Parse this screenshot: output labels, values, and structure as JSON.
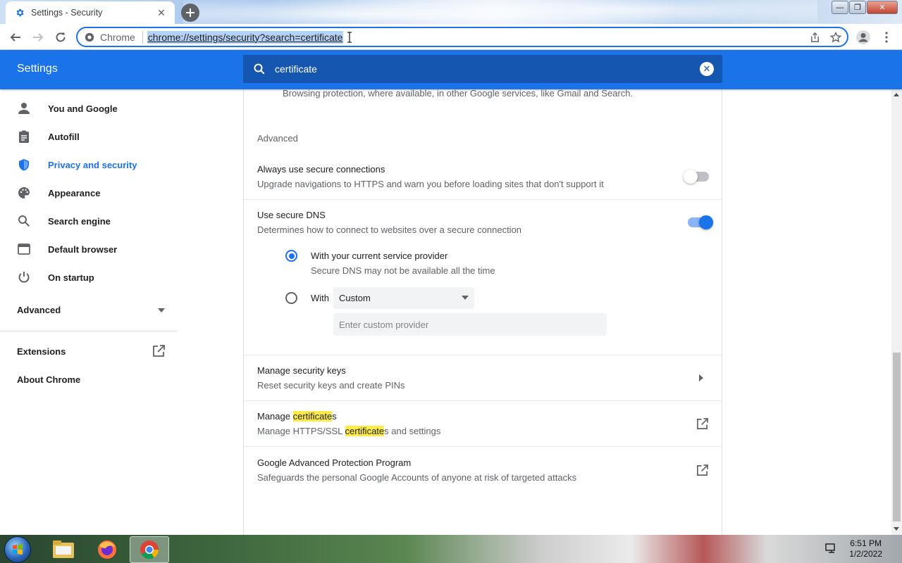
{
  "tab": {
    "title": "Settings - Security",
    "close": "✕"
  },
  "window_controls": {
    "minimize": "—",
    "maximize": "❐",
    "close": "✕"
  },
  "omnibox": {
    "chip_label": "Chrome",
    "url": "chrome://settings/security?search=certificate"
  },
  "settings_header": {
    "title": "Settings",
    "search_query": "certificate"
  },
  "sidebar": {
    "items": [
      {
        "label": "You and Google",
        "icon": "person-icon"
      },
      {
        "label": "Autofill",
        "icon": "clipboard-icon"
      },
      {
        "label": "Privacy and security",
        "icon": "shield-icon",
        "active": true
      },
      {
        "label": "Appearance",
        "icon": "palette-icon"
      },
      {
        "label": "Search engine",
        "icon": "search-icon"
      },
      {
        "label": "Default browser",
        "icon": "browser-icon"
      },
      {
        "label": "On startup",
        "icon": "power-icon"
      }
    ],
    "advanced": "Advanced",
    "extensions": "Extensions",
    "about": "About Chrome"
  },
  "main": {
    "top_partial": "Browsing protection, where available, in other Google services, like Gmail and Search.",
    "section_title": "Advanced",
    "secure_connections": {
      "title": "Always use secure connections",
      "description": "Upgrade navigations to HTTPS and warn you before loading sites that don't support it",
      "enabled": false
    },
    "secure_dns": {
      "title": "Use secure DNS",
      "description": "Determines how to connect to websites over a secure connection",
      "enabled": true,
      "option_current": {
        "title": "With your current service provider",
        "description": "Secure DNS may not be available all the time",
        "selected": true
      },
      "option_with": {
        "label": "With",
        "selected_value": "Custom",
        "custom_placeholder": "Enter custom provider"
      }
    },
    "security_keys": {
      "title": "Manage security keys",
      "description": "Reset security keys and create PINs"
    },
    "certificates": {
      "title_pre": "Manage ",
      "title_hl": "certificate",
      "title_post": "s",
      "desc_pre": "Manage HTTPS/SSL ",
      "desc_hl": "certificate",
      "desc_post": "s and settings"
    },
    "advanced_protection": {
      "title": "Google Advanced Protection Program",
      "description": "Safeguards the personal Google Accounts of anyone at risk of targeted attacks"
    }
  },
  "taskbar": {
    "time": "6:51 PM",
    "date": "1/2/2022"
  },
  "colors": {
    "accent": "#1a73e8",
    "header_bg": "#1a73e8",
    "search_bg": "#1557b0",
    "highlight": "#fdea47"
  }
}
